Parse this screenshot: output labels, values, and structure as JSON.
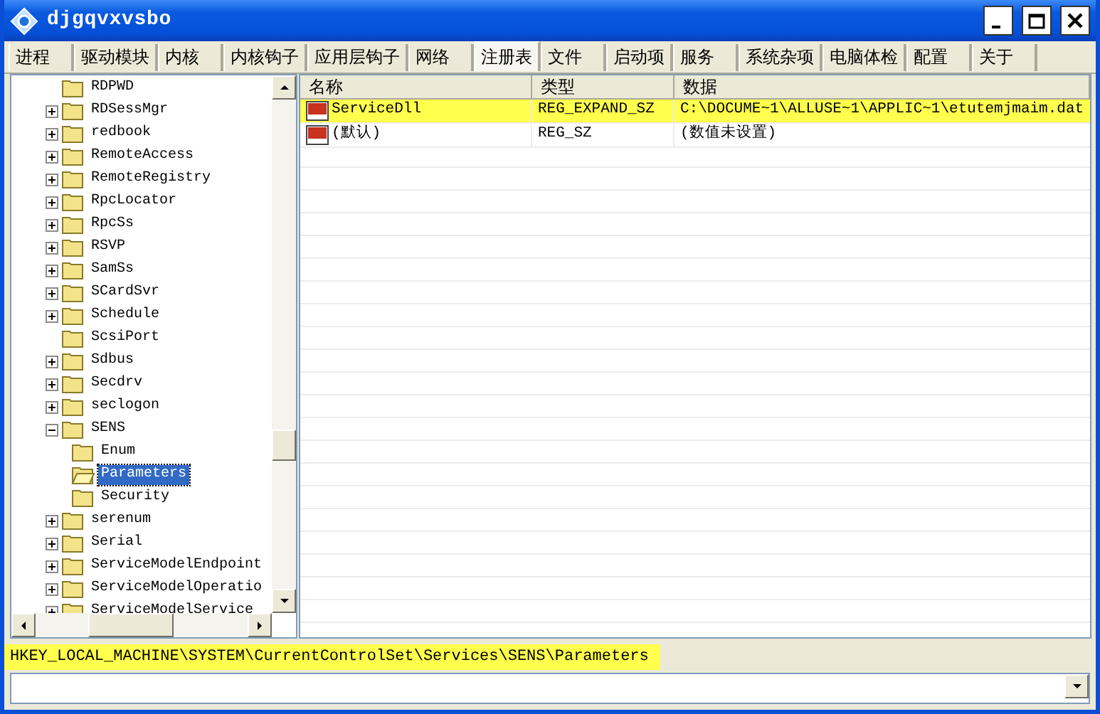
{
  "window": {
    "title": "djgqvxvsbo"
  },
  "tabs": [
    {
      "label": "进程",
      "selected": false
    },
    {
      "label": "驱动模块",
      "selected": false
    },
    {
      "label": "内核",
      "selected": false
    },
    {
      "label": "内核钩子",
      "selected": false
    },
    {
      "label": "应用层钩子",
      "selected": false
    },
    {
      "label": "网络",
      "selected": false
    },
    {
      "label": "注册表",
      "selected": true
    },
    {
      "label": "文件",
      "selected": false
    },
    {
      "label": "启动项",
      "selected": false
    },
    {
      "label": "服务",
      "selected": false
    },
    {
      "label": "系统杂项",
      "selected": false
    },
    {
      "label": "电脑体检",
      "selected": false
    },
    {
      "label": "配置",
      "selected": false
    },
    {
      "label": "关于",
      "selected": false
    }
  ],
  "tree": {
    "items": [
      {
        "label": "RDPWD",
        "kind": "leaf",
        "selected": false
      },
      {
        "label": "RDSessMgr",
        "kind": "branch",
        "expanded": false,
        "selected": false
      },
      {
        "label": "redbook",
        "kind": "branch",
        "expanded": false,
        "selected": false
      },
      {
        "label": "RemoteAccess",
        "kind": "branch",
        "expanded": false,
        "selected": false
      },
      {
        "label": "RemoteRegistry",
        "kind": "branch",
        "expanded": false,
        "selected": false
      },
      {
        "label": "RpcLocator",
        "kind": "branch",
        "expanded": false,
        "selected": false
      },
      {
        "label": "RpcSs",
        "kind": "branch",
        "expanded": false,
        "selected": false
      },
      {
        "label": "RSVP",
        "kind": "branch",
        "expanded": false,
        "selected": false
      },
      {
        "label": "SamSs",
        "kind": "branch",
        "expanded": false,
        "selected": false
      },
      {
        "label": "SCardSvr",
        "kind": "branch",
        "expanded": false,
        "selected": false
      },
      {
        "label": "Schedule",
        "kind": "branch",
        "expanded": false,
        "selected": false
      },
      {
        "label": "ScsiPort",
        "kind": "leaf",
        "selected": false
      },
      {
        "label": "Sdbus",
        "kind": "branch",
        "expanded": false,
        "selected": false
      },
      {
        "label": "Secdrv",
        "kind": "branch",
        "expanded": false,
        "selected": false
      },
      {
        "label": "seclogon",
        "kind": "branch",
        "expanded": false,
        "selected": false
      },
      {
        "label": "SENS",
        "kind": "branch",
        "expanded": true,
        "selected": false,
        "children": [
          {
            "label": "Enum",
            "selected": false
          },
          {
            "label": "Parameters",
            "selected": true
          },
          {
            "label": "Security",
            "selected": false
          }
        ]
      },
      {
        "label": "serenum",
        "kind": "branch",
        "expanded": false,
        "selected": false
      },
      {
        "label": "Serial",
        "kind": "branch",
        "expanded": false,
        "selected": false
      },
      {
        "label": "ServiceModelEndpoint",
        "kind": "branch",
        "expanded": false,
        "selected": false
      },
      {
        "label": "ServiceModelOperatio",
        "kind": "branch",
        "expanded": false,
        "selected": false
      },
      {
        "label": "ServiceModelService",
        "kind": "branch",
        "expanded": false,
        "selected": false
      }
    ]
  },
  "table": {
    "columns": [
      "名称",
      "类型",
      "数据"
    ],
    "rows": [
      {
        "name": "ServiceDll",
        "type": "REG_EXPAND_SZ",
        "data": "C:\\DOCUME~1\\ALLUSE~1\\APPLIC~1\\etutemjmaim.dat",
        "highlighted": true
      },
      {
        "name": "(默认)",
        "type": "REG_SZ",
        "data": "(数值未设置)",
        "highlighted": false
      }
    ]
  },
  "status_bar": {
    "path": "HKEY_LOCAL_MACHINE\\SYSTEM\\CurrentControlSet\\Services\\SENS\\Parameters",
    "highlighted": true
  }
}
